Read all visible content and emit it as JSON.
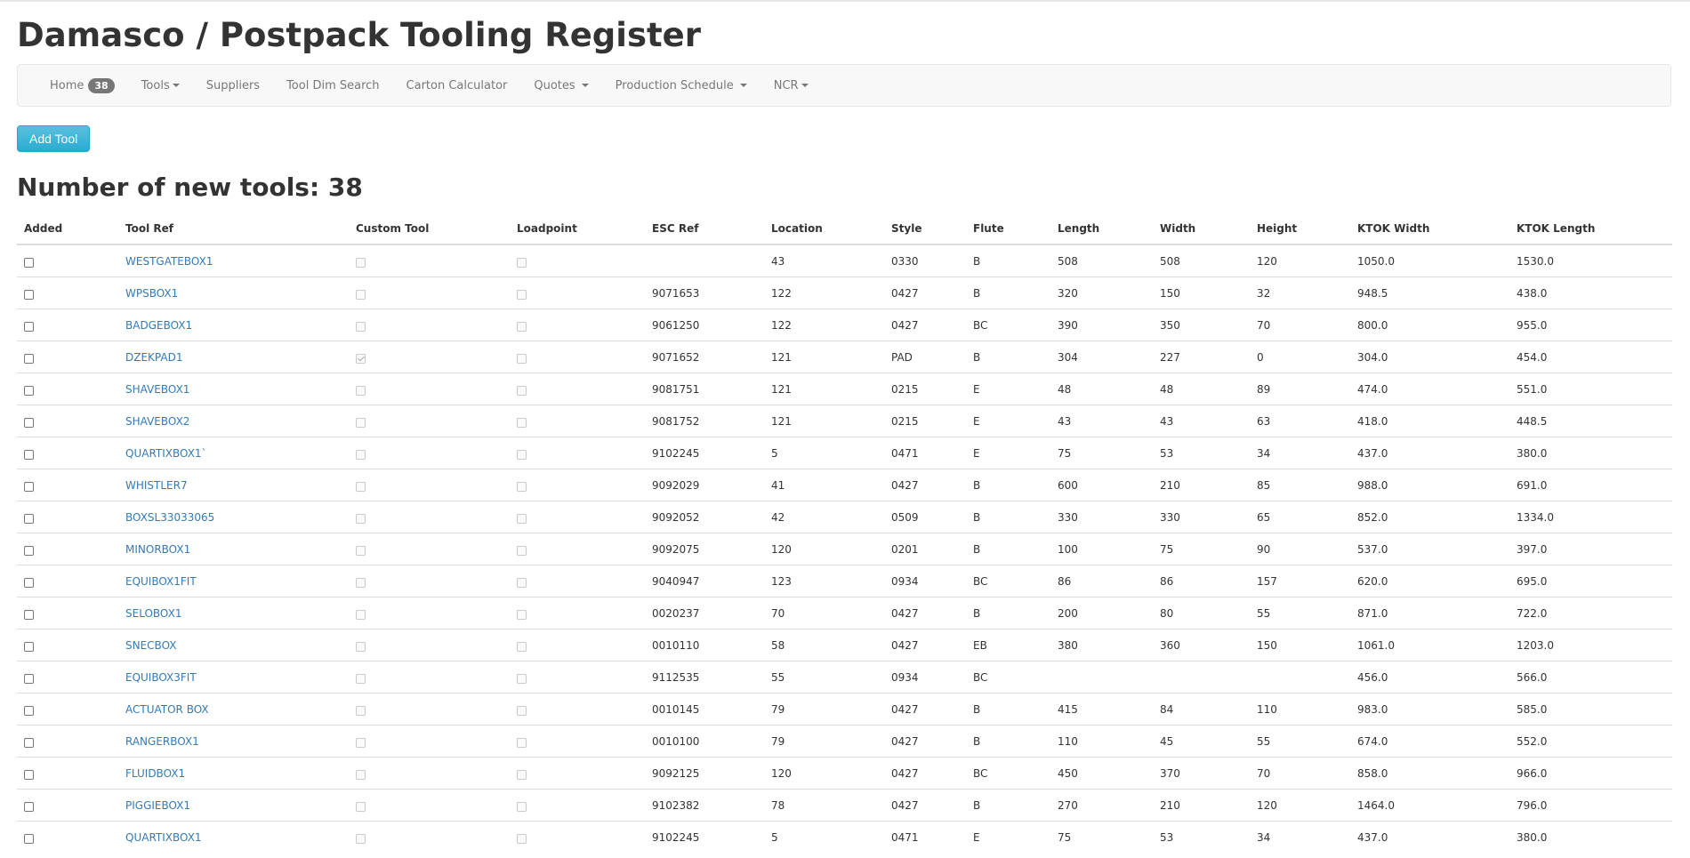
{
  "page": {
    "title": "Damasco / Postpack Tooling Register"
  },
  "nav": {
    "home_label": "Home",
    "home_badge": "38",
    "tools_label": "Tools",
    "suppliers_label": "Suppliers",
    "tool_dim_search_label": "Tool Dim Search",
    "carton_calculator_label": "Carton Calculator",
    "quotes_label": "Quotes",
    "production_schedule_label": "Production Schedule",
    "ncr_label": "NCR"
  },
  "actions": {
    "add_tool_label": "Add Tool"
  },
  "summary": {
    "heading": "Number of new tools: 38"
  },
  "table": {
    "headers": [
      "Added",
      "Tool Ref",
      "Custom Tool",
      "Loadpoint",
      "ESC Ref",
      "Location",
      "Style",
      "Flute",
      "Length",
      "Width",
      "Height",
      "KTOK Width",
      "KTOK Length"
    ],
    "rows": [
      {
        "added": false,
        "tool_ref": "WESTGATEBOX1",
        "custom_tool": false,
        "loadpoint": false,
        "esc_ref": "",
        "location": "43",
        "style": "0330",
        "flute": "B",
        "length": "508",
        "width": "508",
        "height": "120",
        "ktok_width": "1050.0",
        "ktok_length": "1530.0"
      },
      {
        "added": false,
        "tool_ref": "WPSBOX1",
        "custom_tool": false,
        "loadpoint": false,
        "esc_ref": "9071653",
        "location": "122",
        "style": "0427",
        "flute": "B",
        "length": "320",
        "width": "150",
        "height": "32",
        "ktok_width": "948.5",
        "ktok_length": "438.0"
      },
      {
        "added": false,
        "tool_ref": "BADGEBOX1",
        "custom_tool": false,
        "loadpoint": false,
        "esc_ref": "9061250",
        "location": "122",
        "style": "0427",
        "flute": "BC",
        "length": "390",
        "width": "350",
        "height": "70",
        "ktok_width": "800.0",
        "ktok_length": "955.0"
      },
      {
        "added": false,
        "tool_ref": "DZEKPAD1",
        "custom_tool": true,
        "loadpoint": false,
        "esc_ref": "9071652",
        "location": "121",
        "style": "PAD",
        "flute": "B",
        "length": "304",
        "width": "227",
        "height": "0",
        "ktok_width": "304.0",
        "ktok_length": "454.0"
      },
      {
        "added": false,
        "tool_ref": "SHAVEBOX1",
        "custom_tool": false,
        "loadpoint": false,
        "esc_ref": "9081751",
        "location": "121",
        "style": "0215",
        "flute": "E",
        "length": "48",
        "width": "48",
        "height": "89",
        "ktok_width": "474.0",
        "ktok_length": "551.0"
      },
      {
        "added": false,
        "tool_ref": "SHAVEBOX2",
        "custom_tool": false,
        "loadpoint": false,
        "esc_ref": "9081752",
        "location": "121",
        "style": "0215",
        "flute": "E",
        "length": "43",
        "width": "43",
        "height": "63",
        "ktok_width": "418.0",
        "ktok_length": "448.5"
      },
      {
        "added": false,
        "tool_ref": "QUARTIXBOX1`",
        "custom_tool": false,
        "loadpoint": false,
        "esc_ref": "9102245",
        "location": "5",
        "style": "0471",
        "flute": "E",
        "length": "75",
        "width": "53",
        "height": "34",
        "ktok_width": "437.0",
        "ktok_length": "380.0"
      },
      {
        "added": false,
        "tool_ref": "WHISTLER7",
        "custom_tool": false,
        "loadpoint": false,
        "esc_ref": "9092029",
        "location": "41",
        "style": "0427",
        "flute": "B",
        "length": "600",
        "width": "210",
        "height": "85",
        "ktok_width": "988.0",
        "ktok_length": "691.0"
      },
      {
        "added": false,
        "tool_ref": "BOXSL33033065",
        "custom_tool": false,
        "loadpoint": false,
        "esc_ref": "9092052",
        "location": "42",
        "style": "0509",
        "flute": "B",
        "length": "330",
        "width": "330",
        "height": "65",
        "ktok_width": "852.0",
        "ktok_length": "1334.0"
      },
      {
        "added": false,
        "tool_ref": "MINORBOX1",
        "custom_tool": false,
        "loadpoint": false,
        "esc_ref": "9092075",
        "location": "120",
        "style": "0201",
        "flute": "B",
        "length": "100",
        "width": "75",
        "height": "90",
        "ktok_width": "537.0",
        "ktok_length": "397.0"
      },
      {
        "added": false,
        "tool_ref": "EQUIBOX1FIT",
        "custom_tool": false,
        "loadpoint": false,
        "esc_ref": "9040947",
        "location": "123",
        "style": "0934",
        "flute": "BC",
        "length": "86",
        "width": "86",
        "height": "157",
        "ktok_width": "620.0",
        "ktok_length": "695.0"
      },
      {
        "added": false,
        "tool_ref": "SELOBOX1",
        "custom_tool": false,
        "loadpoint": false,
        "esc_ref": "0020237",
        "location": "70",
        "style": "0427",
        "flute": "B",
        "length": "200",
        "width": "80",
        "height": "55",
        "ktok_width": "871.0",
        "ktok_length": "722.0"
      },
      {
        "added": false,
        "tool_ref": "SNECBOX",
        "custom_tool": false,
        "loadpoint": false,
        "esc_ref": "0010110",
        "location": "58",
        "style": "0427",
        "flute": "EB",
        "length": "380",
        "width": "360",
        "height": "150",
        "ktok_width": "1061.0",
        "ktok_length": "1203.0"
      },
      {
        "added": false,
        "tool_ref": "EQUIBOX3FIT",
        "custom_tool": false,
        "loadpoint": false,
        "esc_ref": "9112535",
        "location": "55",
        "style": "0934",
        "flute": "BC",
        "length": "",
        "width": "",
        "height": "",
        "ktok_width": "456.0",
        "ktok_length": "566.0"
      },
      {
        "added": false,
        "tool_ref": "ACTUATOR BOX",
        "custom_tool": false,
        "loadpoint": false,
        "esc_ref": "0010145",
        "location": "79",
        "style": "0427",
        "flute": "B",
        "length": "415",
        "width": "84",
        "height": "110",
        "ktok_width": "983.0",
        "ktok_length": "585.0"
      },
      {
        "added": false,
        "tool_ref": "RANGERBOX1",
        "custom_tool": false,
        "loadpoint": false,
        "esc_ref": "0010100",
        "location": "79",
        "style": "0427",
        "flute": "B",
        "length": "110",
        "width": "45",
        "height": "55",
        "ktok_width": "674.0",
        "ktok_length": "552.0"
      },
      {
        "added": false,
        "tool_ref": "FLUIDBOX1",
        "custom_tool": false,
        "loadpoint": false,
        "esc_ref": "9092125",
        "location": "120",
        "style": "0427",
        "flute": "BC",
        "length": "450",
        "width": "370",
        "height": "70",
        "ktok_width": "858.0",
        "ktok_length": "966.0"
      },
      {
        "added": false,
        "tool_ref": "PIGGIEBOX1",
        "custom_tool": false,
        "loadpoint": false,
        "esc_ref": "9102382",
        "location": "78",
        "style": "0427",
        "flute": "B",
        "length": "270",
        "width": "210",
        "height": "120",
        "ktok_width": "1464.0",
        "ktok_length": "796.0"
      },
      {
        "added": false,
        "tool_ref": "QUARTIXBOX1",
        "custom_tool": false,
        "loadpoint": false,
        "esc_ref": "9102245",
        "location": "5",
        "style": "0471",
        "flute": "E",
        "length": "75",
        "width": "53",
        "height": "34",
        "ktok_width": "437.0",
        "ktok_length": "380.0"
      }
    ]
  },
  "colors": {
    "link": "#337ab7",
    "button_info": "#31b0d5",
    "badge": "#777777"
  }
}
